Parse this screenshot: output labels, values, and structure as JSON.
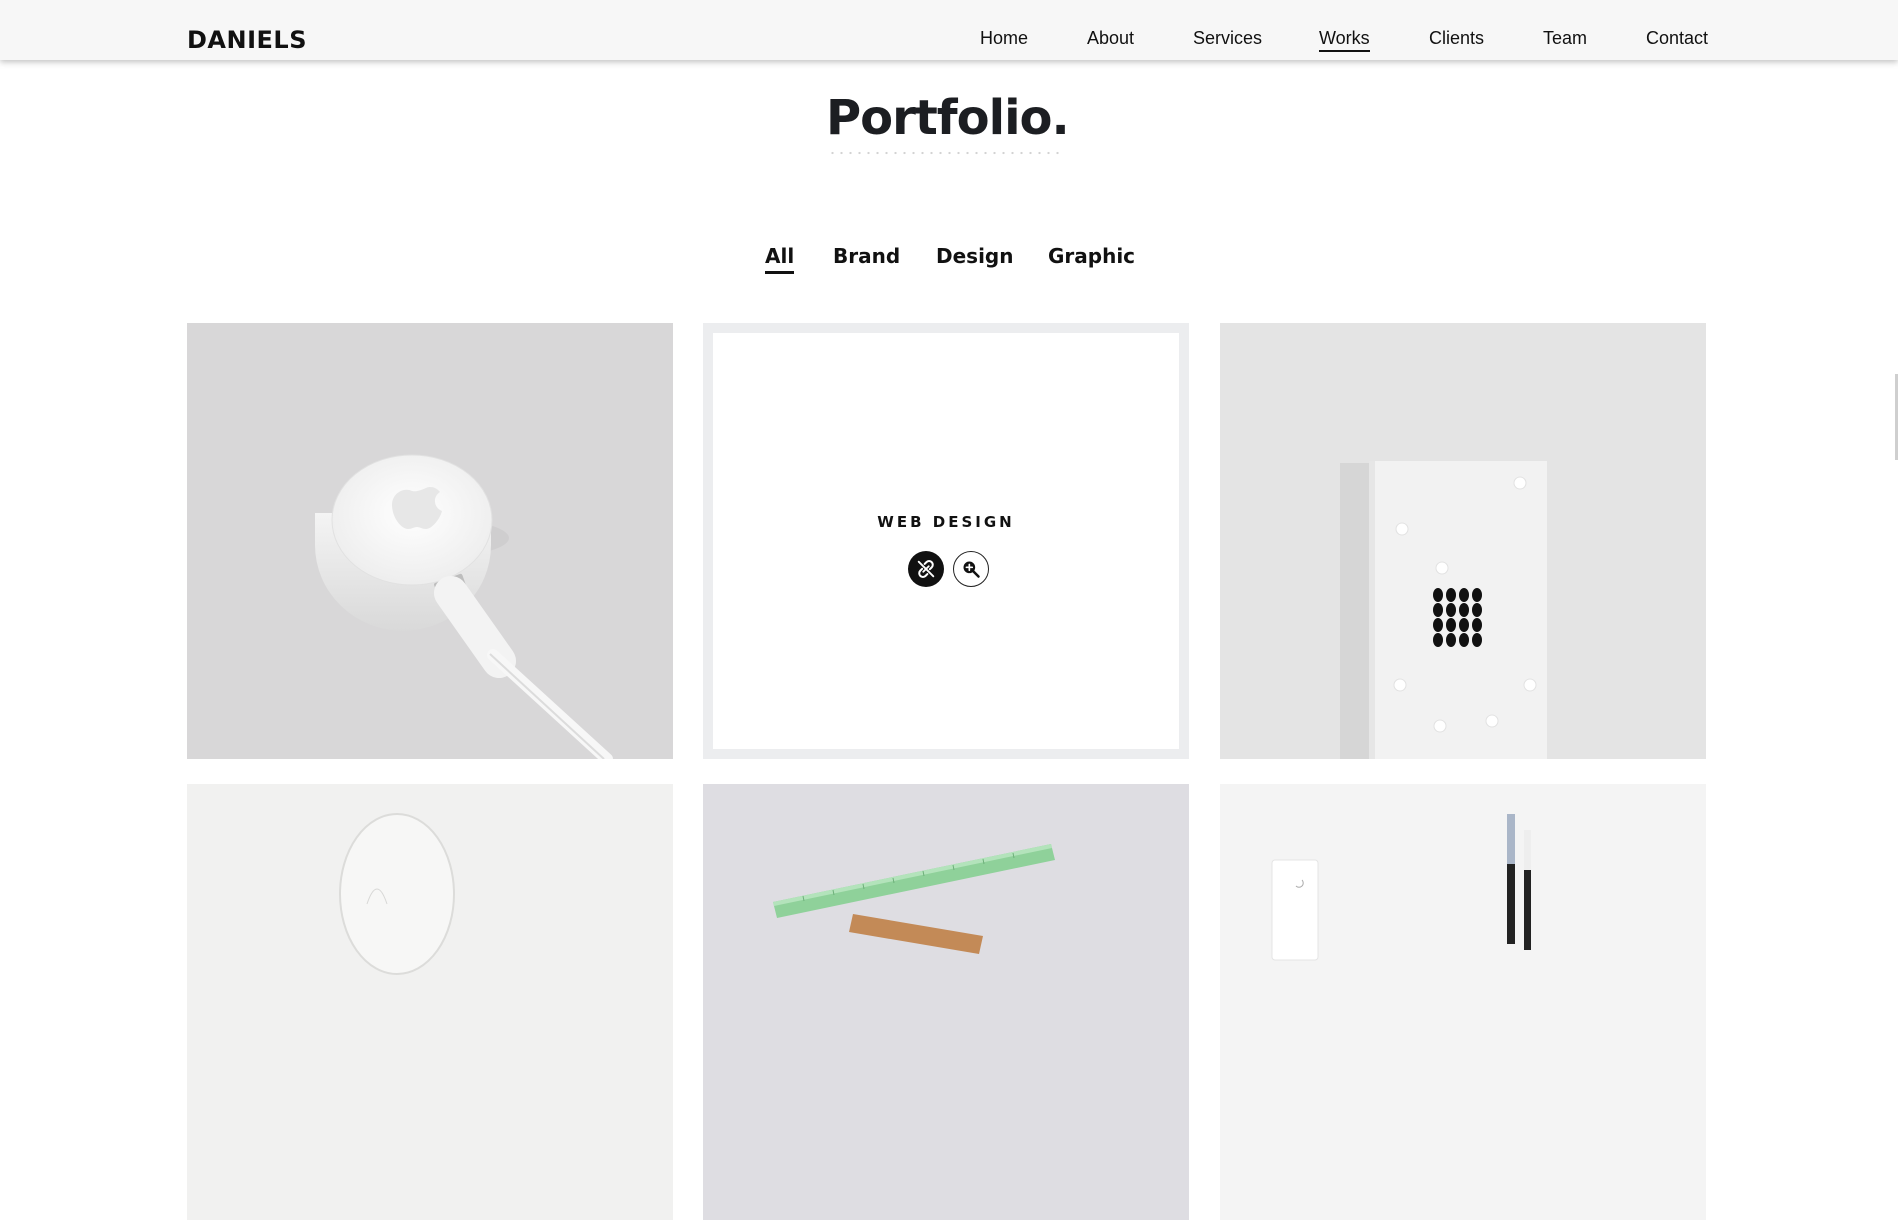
{
  "header": {
    "logo": "DANIELS",
    "nav": [
      "Home",
      "About",
      "Services",
      "Works",
      "Clients",
      "Team",
      "Contact"
    ],
    "active_nav": "Works"
  },
  "section": {
    "title": "Portfolio."
  },
  "filters": {
    "items": [
      "All",
      "Brand",
      "Design",
      "Graphic"
    ],
    "active": "All"
  },
  "portfolio": {
    "items": [
      {
        "image": "apple-watch-charger"
      },
      {
        "image": "web-design-card",
        "category": "WEB DESIGN",
        "actions": [
          "link-icon",
          "zoom-icon"
        ]
      },
      {
        "image": "dotted-card-mockup"
      },
      {
        "image": "light-bulb"
      },
      {
        "image": "rulers-and-pencils"
      },
      {
        "image": "stationery-pens"
      }
    ]
  },
  "colors": {
    "text": "#111111",
    "header_bg": "#f7f7f7",
    "title": "#1c1e22"
  }
}
